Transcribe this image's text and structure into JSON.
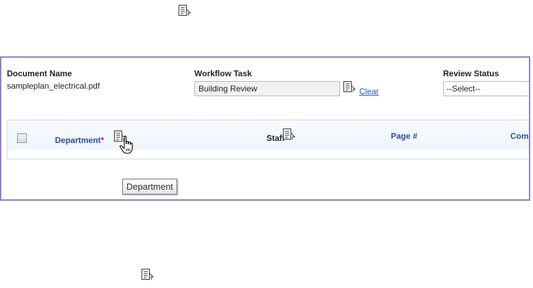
{
  "icons": {
    "top_icon": "fill-down-icon",
    "bottom_icon": "fill-down-icon",
    "workflow_icon": "fill-down-icon",
    "department_icon": "fill-down-icon",
    "staff_icon": "fill-down-icon",
    "cursor": "hand-pointer-icon"
  },
  "colors": {
    "panel_border": "#8b83c5",
    "link": "#1f55b5",
    "column_header": "#2a4f9e",
    "required": "#d21f1f"
  },
  "document": {
    "label": "Document Name",
    "value": "sampleplan_electrical.pdf"
  },
  "workflow": {
    "label": "Workflow Task",
    "value": "Building Review",
    "clear_label": "Clear"
  },
  "review": {
    "label": "Review Status",
    "selected": "--Select--"
  },
  "grid": {
    "columns": {
      "department": "Department",
      "required_mark": "*",
      "staff": "Staff",
      "page": "Page #",
      "comments_partial": "Com"
    }
  },
  "tooltip": {
    "text": "Department"
  }
}
